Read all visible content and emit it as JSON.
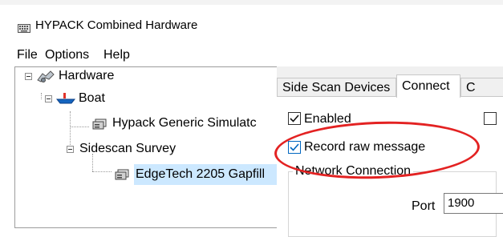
{
  "window": {
    "title": "HYPACK Combined Hardware"
  },
  "menu": {
    "items": [
      "File",
      "Options",
      "Help"
    ]
  },
  "tree": {
    "nodes": [
      {
        "label": "Hardware",
        "icon": "hardware-icon"
      },
      {
        "label": "Boat",
        "icon": "boat-icon"
      },
      {
        "label": "Hypack Generic Simulatc",
        "icon": "device-icon"
      },
      {
        "label": "Sidescan Survey",
        "icon": "none"
      },
      {
        "label": "EdgeTech 2205 Gapfill",
        "icon": "device-icon"
      }
    ]
  },
  "tabs": {
    "items": [
      "Side Scan Devices",
      "Connect",
      "C"
    ],
    "active_index": 1
  },
  "connect": {
    "enabled_label": "Enabled",
    "enabled_checked": true,
    "record_raw_label": "Record raw message",
    "record_raw_checked": true,
    "network_group_label": "Network Connection",
    "port_label": "Port",
    "port_value": "1900"
  },
  "colors": {
    "highlight": "#e32222",
    "selection": "#cce8ff",
    "check": "#0067c0"
  }
}
